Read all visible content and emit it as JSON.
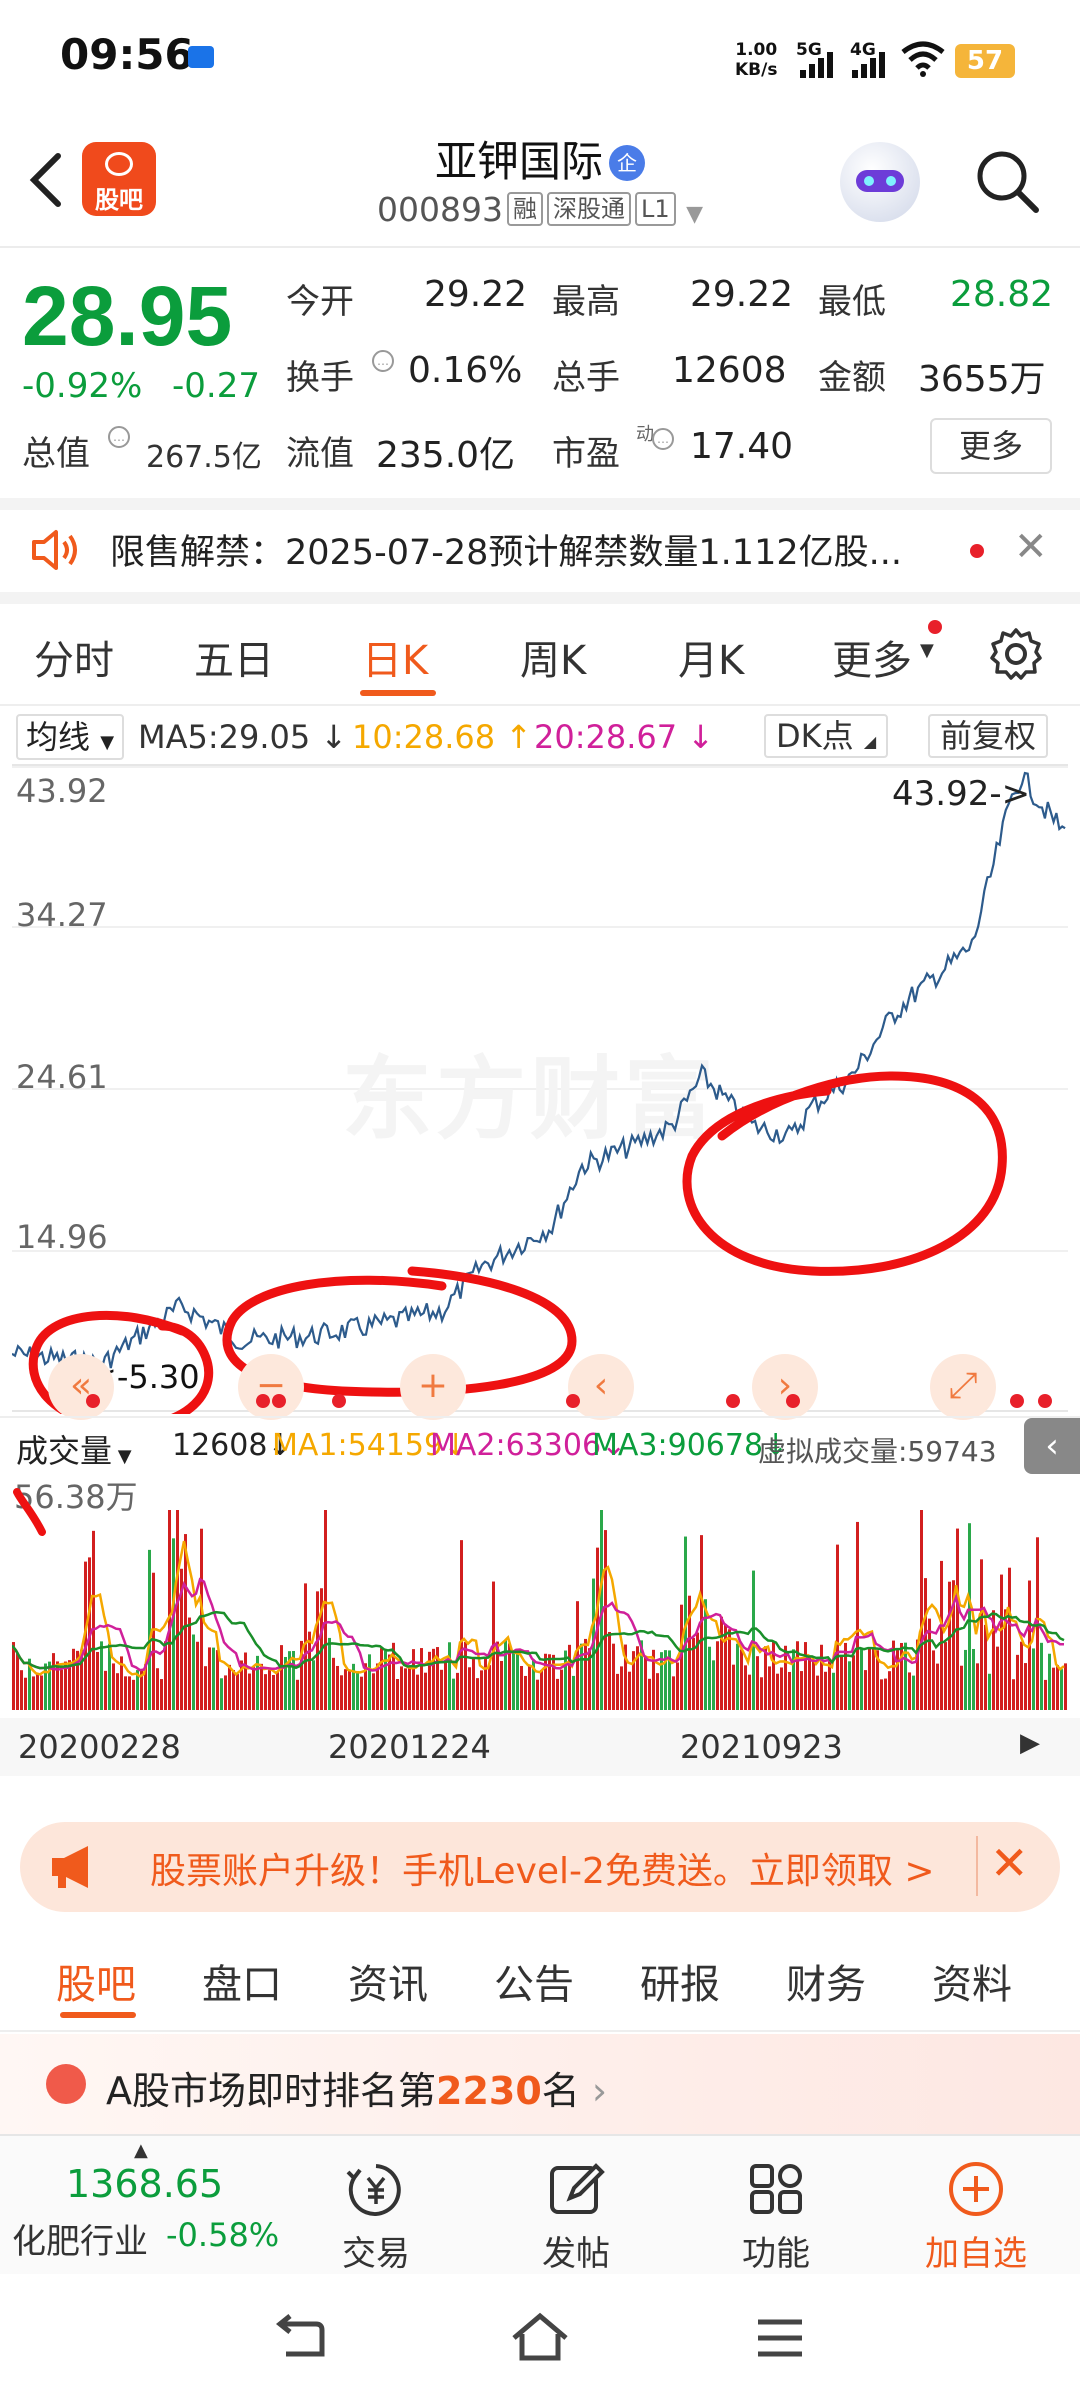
{
  "status_bar": {
    "time": "09:56",
    "speed_value": "1.00",
    "speed_unit": "KB/s",
    "sim1": "5G",
    "sim2": "4G",
    "battery": "57"
  },
  "header": {
    "app_logo_text": "股吧",
    "stock_name": "亚钾国际",
    "badge": "企",
    "stock_code": "000893",
    "tags": [
      "融",
      "深股通",
      "L1"
    ]
  },
  "quote": {
    "price": "28.95",
    "change_pct": "-0.92%",
    "change_amt": "-0.27",
    "open_label": "今开",
    "open": "29.22",
    "high_label": "最高",
    "high": "29.22",
    "low_label": "最低",
    "low": "28.82",
    "turnover_label": "换手",
    "turnover": "0.16%",
    "volume_label": "总手",
    "volume": "12608",
    "amount_label": "金额",
    "amount": "3655万",
    "mktcap_label": "总值",
    "mktcap": "267.5亿",
    "float_label": "流值",
    "float_cap": "235.0亿",
    "pe_label": "市盈",
    "pe_sup": "动",
    "pe": "17.40",
    "more": "更多"
  },
  "notice": {
    "text": "限售解禁：2025-07-28预计解禁数量1.112亿股..."
  },
  "period_tabs": [
    "分时",
    "五日",
    "日K",
    "周K",
    "月K",
    "更多"
  ],
  "active_period": "日K",
  "ma_row": {
    "selector": "均线",
    "ma5": "MA5:29.05 ↓",
    "ma10": "10:28.68 ↑",
    "ma20": "20:28.67 ↓",
    "dk_btn": "DK点",
    "fq_btn": "前复权"
  },
  "kline": {
    "y_labels": [
      "43.92",
      "34.27",
      "24.61",
      "14.96"
    ],
    "bottom_label": "5.30",
    "peak_label": "43.92->",
    "watermark": "东方财富"
  },
  "volume_row": {
    "selector": "成交量",
    "vol": "12608↓",
    "ma1": "MA1:54159↓",
    "ma2": "MA2:63306↓",
    "ma3": "MA3:90678↓",
    "virtual": "虚拟成交量:59743",
    "max_label": "56.38万"
  },
  "dates": [
    "20200228",
    "20201224",
    "20210923"
  ],
  "banner": {
    "text": "股票账户升级！手机Level-2免费送。立即领取 >"
  },
  "content_tabs": [
    "股吧",
    "盘口",
    "资讯",
    "公告",
    "研报",
    "财务",
    "资料"
  ],
  "active_content_tab": "股吧",
  "rank": {
    "prefix": "A股市场即时排名第",
    "number": "2230",
    "suffix": "名"
  },
  "toolbar": {
    "index_value": "1368.65",
    "index_name": "化肥行业",
    "index_change": "-0.58%",
    "trade": "交易",
    "post": "发帖",
    "functions": "功能",
    "add_watch": "加自选"
  },
  "colors": {
    "down_green": "#0b9d3c",
    "accent_orange": "#f05a1c",
    "ma10_yellow": "#f5a800",
    "ma20_magenta": "#d0209a",
    "annotation_red": "#ee1111"
  }
}
